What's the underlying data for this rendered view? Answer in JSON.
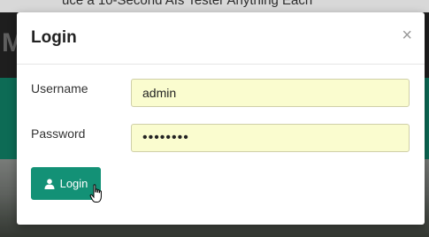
{
  "background": {
    "top_text": "uce a 10-Second AIs Tester Anything Each",
    "logo": "M"
  },
  "modal": {
    "title": "Login",
    "close_symbol": "×",
    "username": {
      "label": "Username",
      "value": "admin"
    },
    "password": {
      "label": "Password",
      "value": "••••••••"
    },
    "login_button": {
      "label": "Login",
      "icon": "user-icon",
      "color": "#139176"
    }
  },
  "colors": {
    "input_autofill": "#fafccf",
    "header_green": "#0f7a61"
  }
}
